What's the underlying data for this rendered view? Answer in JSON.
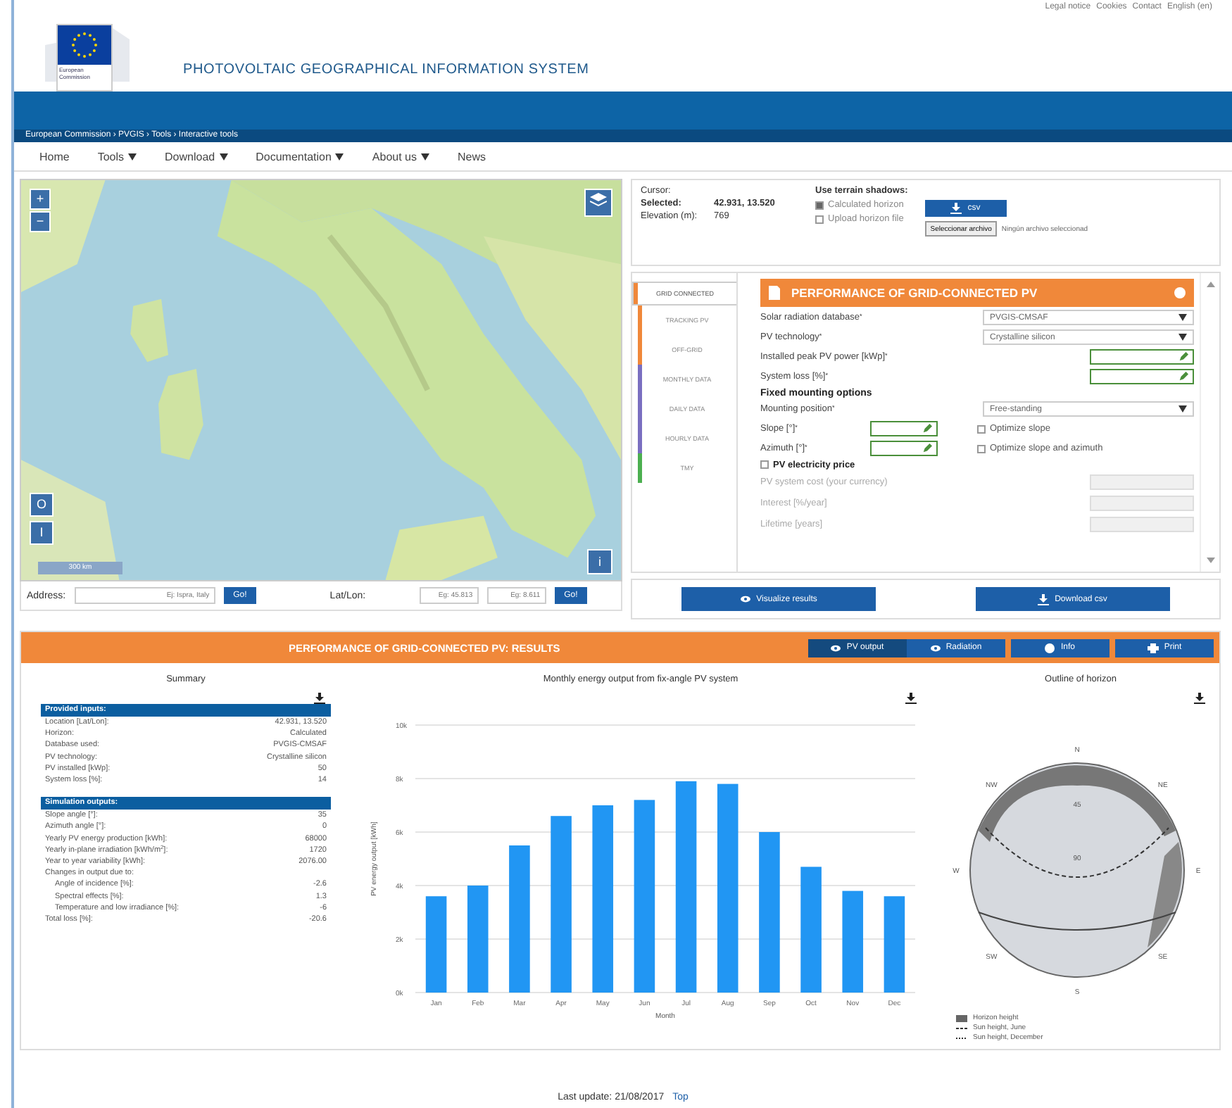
{
  "top_links": [
    "Legal notice",
    "Cookies",
    "Contact",
    "English (en)"
  ],
  "logo": {
    "caption": "European Commission"
  },
  "site_title": "PHOTOVOLTAIC GEOGRAPHICAL INFORMATION SYSTEM",
  "breadcrumb": "European Commission › PVGIS › Tools › Interactive tools",
  "nav": [
    {
      "label": "Home",
      "dropdown": false
    },
    {
      "label": "Tools",
      "dropdown": true
    },
    {
      "label": "Download",
      "dropdown": true
    },
    {
      "label": "Documentation",
      "dropdown": true
    },
    {
      "label": "About us",
      "dropdown": true
    },
    {
      "label": "News",
      "dropdown": false
    }
  ],
  "map": {
    "zoom_in": "+",
    "zoom_out": "−",
    "toggles": [
      "O",
      "I"
    ],
    "scale": "300 km",
    "info": "i"
  },
  "address": {
    "label": "Address:",
    "placeholder": "Ej: Ispra, Italy",
    "go": "Go!"
  },
  "latlon": {
    "label": "Lat/Lon:",
    "lat_placeholder": "Eg: 45.813",
    "lon_placeholder": "Eg: 8.611",
    "go": "Go!"
  },
  "location": [
    {
      "label": "Cursor:"
    },
    {
      "label": "Selected:",
      "value": "42.931, 13.520"
    },
    {
      "label": "Elevation (m):",
      "value": "769"
    }
  ],
  "terrain": {
    "title": "Use terrain shadows:",
    "options": [
      {
        "label": "Calculated horizon",
        "checked": true
      },
      {
        "label": "Upload horizon file",
        "checked": false
      }
    ],
    "csv_button": "csv",
    "file_button": "Seleccionar archivo",
    "file_status": "Ningún archivo seleccionad"
  },
  "side_tabs": [
    {
      "label": "GRID CONNECTED",
      "selected": true,
      "color": "#f0883a"
    },
    {
      "label": "TRACKING PV",
      "selected": false,
      "color": "#f0883a"
    },
    {
      "label": "OFF-GRID",
      "selected": false,
      "color": "#f0883a"
    },
    {
      "label": "MONTHLY DATA",
      "selected": false,
      "color": "#7a6fc0"
    },
    {
      "label": "DAILY DATA",
      "selected": false,
      "color": "#7a6fc0"
    },
    {
      "label": "HOURLY DATA",
      "selected": false,
      "color": "#7a6fc0"
    },
    {
      "label": "TMY",
      "selected": false,
      "color": "#4caf50"
    }
  ],
  "form": {
    "title": "PERFORMANCE OF GRID-CONNECTED PV",
    "fields": [
      {
        "kind": "select",
        "label": "Solar radiation database$^{*}$",
        "value": "PVGIS-CMSAF"
      },
      {
        "kind": "select",
        "label": "PV technology$^{*}$",
        "value": "Crystalline silicon"
      },
      {
        "kind": "input",
        "label": "Installed peak PV power [kWp]$^{*}$"
      },
      {
        "kind": "input",
        "label": "System loss [%]$^{*}$"
      }
    ],
    "mounting_title": "Fixed mounting options",
    "mounting_position": {
      "label": "Mounting position$^{*}$",
      "value": "Free-standing"
    },
    "angles": [
      {
        "label": "Slope [°]$^{*}$",
        "option": "Optimize slope",
        "checked": false
      },
      {
        "label": "Azimuth [°]$^{*}$",
        "option": "Optimize slope and azimuth",
        "checked": false
      }
    ],
    "price": {
      "label": "PV electricity price",
      "checked": false
    },
    "price_fields": [
      {
        "label": "PV system cost (your currency)",
        "disabled": true
      },
      {
        "label": "Interest [%/year]",
        "disabled": true
      },
      {
        "label": "Lifetime [years]",
        "disabled": true
      }
    ]
  },
  "actions": [
    "Visualize results",
    "Download csv"
  ],
  "results": {
    "title": "PERFORMANCE OF GRID-CONNECTED PV: RESULTS",
    "views": [
      {
        "label": "PV output",
        "selected": true
      },
      {
        "label": "Radiation",
        "selected": false
      }
    ],
    "tools": [
      {
        "kind": "info",
        "label": "Info"
      },
      {
        "kind": "print",
        "label": "Print"
      }
    ]
  },
  "summary": {
    "title": "Summary",
    "sections": [
      {
        "title": "Provided inputs:",
        "rows": [
          {
            "label": "Location [Lat/Lon]:",
            "value": "42.931, 13.520"
          },
          {
            "label": "Horizon:",
            "value": "Calculated"
          },
          {
            "label": "Database used:",
            "value": "PVGIS-CMSAF"
          },
          {
            "label": "PV technology:",
            "value": "Crystalline silicon"
          },
          {
            "label": "PV installed [kWp]:",
            "value": "50"
          },
          {
            "label": "System loss [%]:",
            "value": "14"
          }
        ]
      },
      {
        "title": "Simulation outputs:",
        "rows": [
          {
            "label": "Slope angle [°]:",
            "value": "35"
          },
          {
            "label": "Azimuth angle [°]:",
            "value": "0"
          },
          {
            "label": "Yearly PV energy production [kWh]:",
            "value": "68000"
          },
          {
            "label": "Yearly in-plane irradiation [kWh/m$^{2}$]:",
            "value": "1720"
          },
          {
            "label": "Year to year variability [kWh]:",
            "value": "2076.00"
          },
          {
            "label": "Changes in output due to:",
            "children": [
              {
                "label": "Angle of incidence [%]:",
                "value": "-2.6"
              },
              {
                "label": "Spectral effects [%]:",
                "value": "1.3"
              },
              {
                "label": "Temperature and low irradiance [%]:",
                "value": "-6"
              }
            ]
          },
          {
            "label": "Total loss [%]:",
            "value": "-20.6"
          }
        ]
      }
    ]
  },
  "monthly": {
    "chart_data": {
      "type": "bar",
      "title": "Monthly energy output from fix-angle PV system",
      "xlabel": "Month",
      "ylabel": "PV energy output [kWh]",
      "categories": [
        "Jan",
        "Feb",
        "Mar",
        "Apr",
        "May",
        "Jun",
        "Jul",
        "Aug",
        "Sep",
        "Oct",
        "Nov",
        "Dec"
      ],
      "grid": true,
      "series": [
        {
          "color": "#2196f3",
          "values": [
            3600,
            4000,
            5500,
            6600,
            7000,
            7200,
            7900,
            7800,
            6000,
            4700,
            3800,
            3600
          ]
        }
      ],
      "ylim": [
        0,
        10000
      ],
      "yticks": [
        {
          "value": 0,
          "label": "0k"
        },
        {
          "value": 2000,
          "label": "2k"
        },
        {
          "value": 4000,
          "label": "4k"
        },
        {
          "value": 6000,
          "label": "6k"
        },
        {
          "value": 8000,
          "label": "8k"
        },
        {
          "value": 10000,
          "label": "10k"
        }
      ]
    }
  },
  "horizon": {
    "title": "Outline of horizon",
    "directions": [
      "N",
      "NE",
      "E",
      "SE",
      "S",
      "SW",
      "W",
      "NW"
    ],
    "rings": [
      "45",
      "90"
    ],
    "legend": [
      {
        "kind": "area",
        "label": "Horizon height"
      },
      {
        "kind": "dashed",
        "label": "Sun height, June"
      },
      {
        "kind": "dotted",
        "label": "Sun height, December"
      }
    ]
  },
  "footer": {
    "text": "Last update: 21/08/2017",
    "link": "Top"
  }
}
